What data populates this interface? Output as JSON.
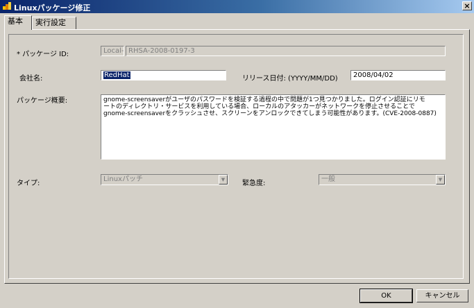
{
  "window": {
    "title": "Linuxパッケージ修正",
    "close_glyph": "×"
  },
  "tabs": [
    {
      "label": "基本",
      "active": true
    },
    {
      "label": "実行設定",
      "active": false
    }
  ],
  "form": {
    "package_id": {
      "label": "* パッケージ ID:",
      "prefix": "Local-",
      "value": "RHSA-2008-0197-3"
    },
    "company": {
      "label": "会社名:",
      "value": "RedHat"
    },
    "release_date": {
      "label": "リリース日付: (YYYY/MM/DD)",
      "value": "2008/04/02"
    },
    "summary": {
      "label": "パッケージ概要:",
      "lines": [
        "gnome-screensaverがユーザのパスワードを検証する過程の中で問題が1つ見つかりました。ログイン認証にリモ",
        "ートのディレクトリ・サービスを利用している場合、ローカルのアタッカーがネットワークを停止させることで",
        "gnome-screensaverをクラッシュさせ、スクリーンをアンロックできてしまう可能性があります。(CVE-2008-0887)"
      ]
    },
    "type": {
      "label": "タイプ:",
      "value": "Linuxパッチ"
    },
    "severity": {
      "label": "緊急度:",
      "value": "一般"
    }
  },
  "buttons": {
    "ok": "OK",
    "cancel": "キャンセル"
  }
}
